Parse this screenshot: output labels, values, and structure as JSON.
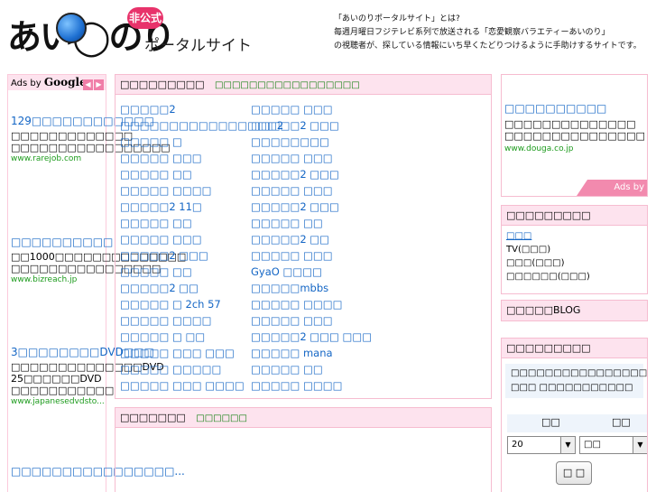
{
  "header": {
    "logo_text": "あい◯のり",
    "badge": "非公式",
    "subtitle": "ポータルサイト",
    "tagline": [
      "「あいのりポータルサイト」とは?",
      "毎週月曜日フジテレビ系列で放送される「恋愛観察バラエティーあいのり」",
      "の視聴者が、探している情報にいち早くたどりつけるように手助けするサイトです。"
    ]
  },
  "left_ads": {
    "label_prefix": "Ads by ",
    "label_brand": "Google",
    "prev_icon": "◀",
    "next_icon": "▶",
    "items": [
      {
        "title": "129□□□□□□□□□□□□",
        "desc": "□□□□□□□□□□□□□ □□□□□□□□□□□□□□□□□",
        "url": "www.rarejob.com"
      },
      {
        "title": "□□□□□□□□□□",
        "desc": "□□1000□□□□□□□□□□□□□□ □□□□□□□□□□□□□□□□",
        "url": "www.bizreach.jp"
      },
      {
        "title": "3□□□□□□□□DVD□□□",
        "desc": "□□□□□□□□□□□□□□DVD 25□□□□□□DVD □□□□□□□□□□□",
        "url": "www.japanesedvdsto..."
      },
      {
        "title": "□□□□□□□□□□□□□□□□...",
        "desc": "",
        "url": ""
      }
    ]
  },
  "links_panel": {
    "title": "□□□□□□□□□",
    "subtitle": "□□□□□□□□□□□□□□□□□",
    "col1": [
      "□□□□□2",
      "□□□□□□□□□□□□□□□□2",
      "□□□□□ □",
      "□□□□□ □□□",
      "□□□□□ □□",
      "□□□□□ □□□□",
      "□□□□□2 11□",
      "□□□□□ □□",
      "□□□□□ □□□",
      "□□□□□2 □□□",
      "□□□□□ □□",
      "□□□□□2 □□",
      "□□□□□ □ 2ch 57",
      "□□□□□ □□□□",
      "□□□□□ □ □□",
      "□□□□□ □□□ □□□",
      "□□□□□ □□□□□",
      "□□□□□ □□□ □□□□"
    ],
    "col2": [
      "□□□□□ □□□",
      "□□□□□2 □□□",
      "□□□□□□□□",
      "□□□□□ □□□",
      "□□□□□2 □□□",
      "□□□□□ □□□",
      "□□□□□2 □□□",
      "□□□□□ □□",
      "□□□□□2 □□",
      "□□□□□ □□□",
      "GyaO □□□□",
      "□□□□□mbbs",
      "□□□□□ □□□□",
      "□□□□□ □□□",
      "□□□□□2 □□□ □□□",
      "□□□□□ mana",
      "□□□□□ □□",
      "□□□□□ □□□□"
    ]
  },
  "second_panel": {
    "title": "□□□□□□□",
    "subtitle": "□□□□□□"
  },
  "right_ad": {
    "title": "□□□□□□□□□□",
    "desc": "□□□□□□□□□□□□□□ □□□□□□□□□□□□□□□",
    "url": "www.douga.co.jp",
    "tag_prefix": "Ads by ",
    "tag_brand": "Google"
  },
  "box1": {
    "title": "□□□□□□□□□",
    "links": [
      "□□□",
      "TV(□□□)",
      "□□□(□□□)",
      "□□□□□□(□□□)"
    ]
  },
  "box2": {
    "title": "□□□□□BLOG"
  },
  "box3": {
    "title": "□□□□□□□□□",
    "note": "□□□□□□□□□□□□□□□□□□□□□□□□ □□□ □□□□□□□□□□□",
    "label1": "□□",
    "label2": "□□",
    "select1_value": "20",
    "select2_value": "□□",
    "arrow_icon": "▼",
    "button_label": "□ □"
  }
}
